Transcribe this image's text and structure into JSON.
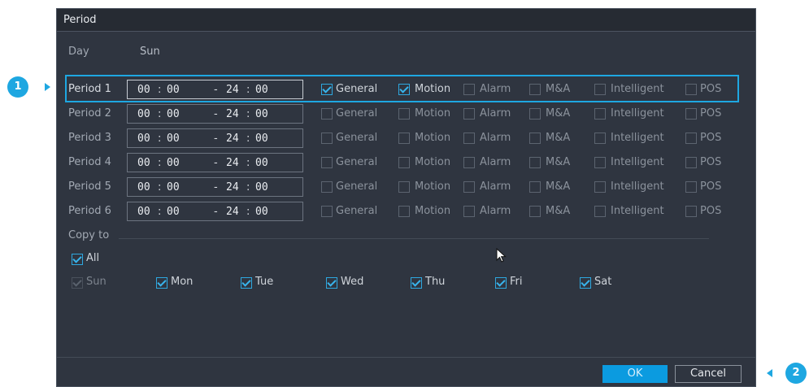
{
  "dialog": {
    "title": "Period"
  },
  "day": {
    "label": "Day",
    "value": "Sun"
  },
  "periods": [
    {
      "label": "Period 1",
      "start_h": "00",
      "start_m": "00",
      "end_h": "24",
      "end_m": "00",
      "general": true,
      "motion": true,
      "alarm": false,
      "ma": false,
      "intelligent": false,
      "pos": false
    },
    {
      "label": "Period 2",
      "start_h": "00",
      "start_m": "00",
      "end_h": "24",
      "end_m": "00",
      "general": false,
      "motion": false,
      "alarm": false,
      "ma": false,
      "intelligent": false,
      "pos": false
    },
    {
      "label": "Period 3",
      "start_h": "00",
      "start_m": "00",
      "end_h": "24",
      "end_m": "00",
      "general": false,
      "motion": false,
      "alarm": false,
      "ma": false,
      "intelligent": false,
      "pos": false
    },
    {
      "label": "Period 4",
      "start_h": "00",
      "start_m": "00",
      "end_h": "24",
      "end_m": "00",
      "general": false,
      "motion": false,
      "alarm": false,
      "ma": false,
      "intelligent": false,
      "pos": false
    },
    {
      "label": "Period 5",
      "start_h": "00",
      "start_m": "00",
      "end_h": "24",
      "end_m": "00",
      "general": false,
      "motion": false,
      "alarm": false,
      "ma": false,
      "intelligent": false,
      "pos": false
    },
    {
      "label": "Period 6",
      "start_h": "00",
      "start_m": "00",
      "end_h": "24",
      "end_m": "00",
      "general": false,
      "motion": false,
      "alarm": false,
      "ma": false,
      "intelligent": false,
      "pos": false
    }
  ],
  "time_separator": ":",
  "range_separator": "-",
  "event_types": {
    "general": "General",
    "motion": "Motion",
    "alarm": "Alarm",
    "ma": "M&A",
    "intelligent": "Intelligent",
    "pos": "POS"
  },
  "copy_to": {
    "label": "Copy to",
    "all": {
      "label": "All",
      "checked": true
    },
    "days": [
      {
        "label": "Sun",
        "checked": true,
        "disabled": true
      },
      {
        "label": "Mon",
        "checked": true,
        "disabled": false
      },
      {
        "label": "Tue",
        "checked": true,
        "disabled": false
      },
      {
        "label": "Wed",
        "checked": true,
        "disabled": false
      },
      {
        "label": "Thu",
        "checked": true,
        "disabled": false
      },
      {
        "label": "Fri",
        "checked": true,
        "disabled": false
      },
      {
        "label": "Sat",
        "checked": true,
        "disabled": false
      }
    ]
  },
  "buttons": {
    "ok": "OK",
    "cancel": "Cancel"
  },
  "callouts": {
    "one": "1",
    "two": "2"
  },
  "colors": {
    "accent": "#1ea7e1",
    "dialog_bg": "#2f3540",
    "titlebar_bg": "#262b33",
    "ok_bg": "#0b9be0"
  }
}
